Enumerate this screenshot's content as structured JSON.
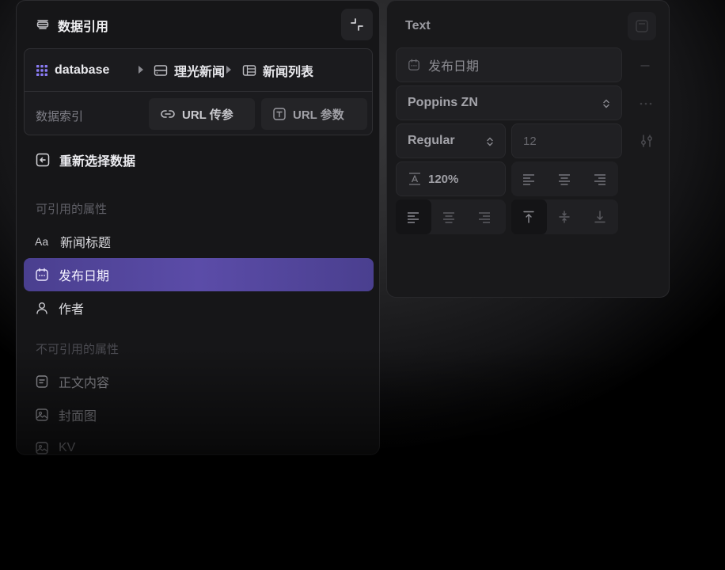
{
  "left_panel": {
    "title": "数据引用",
    "breadcrumb": [
      {
        "label": "database"
      },
      {
        "label": "理光新闻"
      },
      {
        "label": "新闻列表"
      }
    ],
    "index_label": "数据索引",
    "url_buttons": [
      {
        "label": "URL 传参"
      },
      {
        "label": "URL 参数"
      }
    ],
    "reselect_label": "重新选择数据",
    "referable_section": "可引用的属性",
    "referable_items": [
      {
        "label": "新闻标题",
        "icon": "text-type-icon"
      },
      {
        "label": "发布日期",
        "icon": "calendar-icon",
        "selected": true
      },
      {
        "label": "作者",
        "icon": "user-icon"
      }
    ],
    "non_referable_section": "不可引用的属性",
    "non_referable_items": [
      {
        "label": "正文内容",
        "icon": "document-icon"
      },
      {
        "label": "封面图",
        "icon": "image-icon"
      },
      {
        "label": "KV",
        "icon": "image-icon"
      }
    ]
  },
  "right_panel": {
    "title": "Text",
    "bound_field": "发布日期",
    "font_family": "Poppins ZN",
    "font_weight": "Regular",
    "font_size": "12",
    "line_height": "120%"
  },
  "colors": {
    "accent": "#5b4ca8",
    "panel_bg": "#161618",
    "logo_purple": "#8b7cf6"
  }
}
